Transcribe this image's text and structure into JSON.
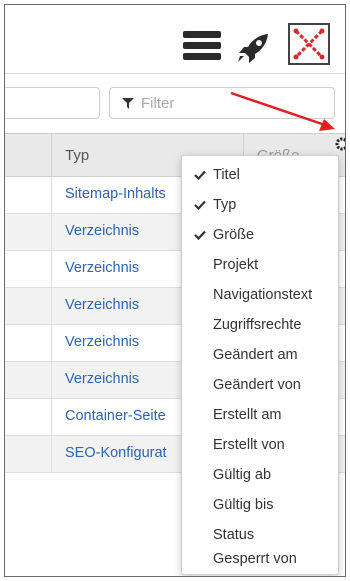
{
  "toolbar": {
    "menu_icon": "hamburger-icon",
    "rocket_icon": "rocket-icon",
    "close_icon": "close-x-icon"
  },
  "filter": {
    "placeholder": "Filter",
    "icon": "filter-funnel-icon"
  },
  "table": {
    "columns": [
      "Typ",
      "Größe"
    ],
    "rows": [
      "Sitemap-Inhalts",
      "Verzeichnis",
      "Verzeichnis",
      "Verzeichnis",
      "Verzeichnis",
      "Verzeichnis",
      "Container-Seite",
      "SEO-Konfigurat"
    ]
  },
  "column_menu": {
    "items": [
      {
        "label": "Titel",
        "checked": true
      },
      {
        "label": "Typ",
        "checked": true
      },
      {
        "label": "Größe",
        "checked": true
      },
      {
        "label": "Projekt",
        "checked": false
      },
      {
        "label": "Navigationstext",
        "checked": false
      },
      {
        "label": "Zugriffsrechte",
        "checked": false
      },
      {
        "label": "Geändert am",
        "checked": false
      },
      {
        "label": "Geändert von",
        "checked": false
      },
      {
        "label": "Erstellt am",
        "checked": false
      },
      {
        "label": "Erstellt von",
        "checked": false
      },
      {
        "label": "Gültig ab",
        "checked": false
      },
      {
        "label": "Gültig bis",
        "checked": false
      },
      {
        "label": "Status",
        "checked": false
      },
      {
        "label": "Gesperrt von",
        "checked": false
      }
    ]
  },
  "colors": {
    "link": "#2d64b3",
    "annotation_arrow": "#e02020",
    "close_x": "#d42a2a"
  }
}
